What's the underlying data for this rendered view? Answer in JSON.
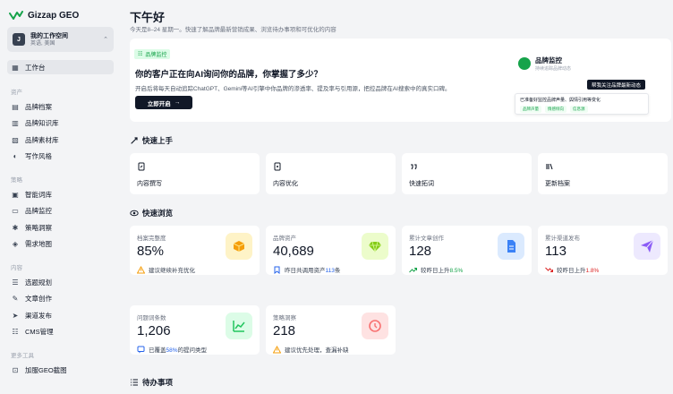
{
  "app": {
    "name": "Gizzap GEO",
    "brand_color": "#16a34a"
  },
  "workspace": {
    "avatar": "J",
    "name": "我的工作空间",
    "region": "英语, 美国"
  },
  "sidebar": {
    "home": {
      "label": "工作台",
      "icon": "dashboard-icon"
    },
    "sections": [
      {
        "title": "资产",
        "items": [
          {
            "label": "品牌档案",
            "icon": "brand-file-icon"
          },
          {
            "label": "品牌知识库",
            "icon": "knowledge-icon"
          },
          {
            "label": "品牌素材库",
            "icon": "material-icon"
          },
          {
            "label": "写作风格",
            "icon": "palette-icon"
          }
        ]
      },
      {
        "title": "策略",
        "items": [
          {
            "label": "智能词库",
            "icon": "smart-words-icon"
          },
          {
            "label": "品牌监控",
            "icon": "monitor-icon"
          },
          {
            "label": "策略洞察",
            "icon": "lightbulb-icon"
          },
          {
            "label": "需求地图",
            "icon": "map-icon"
          }
        ]
      },
      {
        "title": "内容",
        "items": [
          {
            "label": "选题规划",
            "icon": "topic-icon"
          },
          {
            "label": "文章创作",
            "icon": "edit-icon"
          },
          {
            "label": "渠道发布",
            "icon": "send-icon"
          },
          {
            "label": "CMS管理",
            "icon": "cms-icon"
          }
        ]
      },
      {
        "title": "更多工具",
        "items": [
          {
            "label": "加服GEO截图",
            "icon": "screenshot-icon"
          }
        ]
      }
    ]
  },
  "header": {
    "greeting": "下午好",
    "subtitle": "今天是8–24 星期一。快速了解品牌最新营销成果、浏览待办事项和可优化的内容"
  },
  "banner": {
    "tag": "品牌监控",
    "title": "你的客户正在向AI询问你的品牌，你掌握了多少？",
    "desc": "开启后将每天自动追踪ChatGPT、Gemini等AI引擎中你品牌的渗透率、提及率与引用源，把控品牌在AI搜索中的真实口碑。",
    "button": "立即开启",
    "mock": {
      "title": "品牌监控",
      "subtitle": "持续追踪品牌动态",
      "bubble": "帮我关注品牌最新动态",
      "card_text": "已准备好监控品牌声量、舆情引用等变化",
      "chips": [
        "品牌声量",
        "情感倾向",
        "信息源"
      ]
    }
  },
  "quick_start": {
    "title": "快速上手",
    "cards": [
      {
        "label": "内容撰写",
        "icon": "write-icon"
      },
      {
        "label": "内容优化",
        "icon": "optimize-icon"
      },
      {
        "label": "快速拓词",
        "icon": "quote-icon"
      },
      {
        "label": "更新档案",
        "icon": "archive-icon"
      }
    ]
  },
  "overview": {
    "title": "快速浏览",
    "stats": [
      {
        "label": "档案完整度",
        "value": "85%",
        "icon": "cube-icon",
        "icon_bg": "#fef3c7",
        "icon_color": "#f59e0b",
        "foot_icon": "warning-icon",
        "foot_color": "#f59e0b",
        "foot_text": "建议继续补充优化",
        "foot_hl": "",
        "foot_suffix": ""
      },
      {
        "label": "品牌资产",
        "value": "40,689",
        "icon": "diamond-icon",
        "icon_bg": "#ecfccb",
        "icon_color": "#84cc16",
        "foot_icon": "bookmark-icon",
        "foot_color": "#2563eb",
        "foot_text": "昨日共调用资产",
        "foot_hl": "113",
        "foot_suffix": "条",
        "hl_class": "hl-blue"
      },
      {
        "label": "累计文章创作",
        "value": "128",
        "icon": "document-icon",
        "icon_bg": "#dbeafe",
        "icon_color": "#3b82f6",
        "foot_icon": "trend-up-icon",
        "foot_color": "#16a34a",
        "foot_text": "较昨日上升",
        "foot_hl": "8.5%",
        "foot_suffix": "",
        "hl_class": "hl-green"
      },
      {
        "label": "累计渠道发布",
        "value": "113",
        "icon": "paper-plane-icon",
        "icon_bg": "#ede9fe",
        "icon_color": "#8b5cf6",
        "foot_icon": "trend-down-icon",
        "foot_color": "#dc2626",
        "foot_text": "较昨日上升",
        "foot_hl": "1.8%",
        "foot_suffix": "",
        "hl_class": "hl-red"
      },
      {
        "label": "问题词条数",
        "value": "1,206",
        "icon": "chart-icon",
        "icon_bg": "#dcfce7",
        "icon_color": "#22c55e",
        "foot_icon": "chat-icon",
        "foot_color": "#2563eb",
        "foot_text": "已覆盖",
        "foot_hl": "58%",
        "foot_suffix": "的提问类型",
        "hl_class": "hl-blue"
      },
      {
        "label": "策略洞察",
        "value": "218",
        "icon": "history-icon",
        "icon_bg": "#fee2e2",
        "icon_color": "#f87171",
        "foot_icon": "warning-icon",
        "foot_color": "#f59e0b",
        "foot_text": "建议优先处理，查漏补缺",
        "foot_hl": "",
        "foot_suffix": ""
      }
    ]
  },
  "todo": {
    "title": "待办事项"
  }
}
